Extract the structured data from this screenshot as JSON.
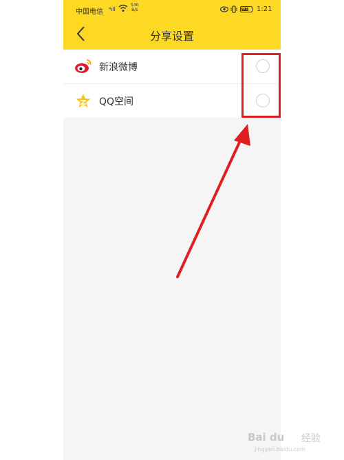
{
  "status_bar": {
    "carrier": "中国电信",
    "signal": "⁴ıll",
    "net_speed_value": "530",
    "net_speed_unit": "B/s",
    "battery": "61",
    "time": "1:21"
  },
  "header": {
    "title": "分享设置"
  },
  "share_options": [
    {
      "label": "新浪微博",
      "icon": "weibo-icon",
      "checked": false
    },
    {
      "label": "QQ空间",
      "icon": "qzone-star-icon",
      "checked": false
    }
  ],
  "annotation": {
    "color": "#e02020"
  },
  "watermark": {
    "brand": "Bai du",
    "sub": "经验",
    "url": "jingyan.baidu.com"
  },
  "colors": {
    "header_bg": "#fdd924",
    "page_bg": "#f5f5f5"
  }
}
